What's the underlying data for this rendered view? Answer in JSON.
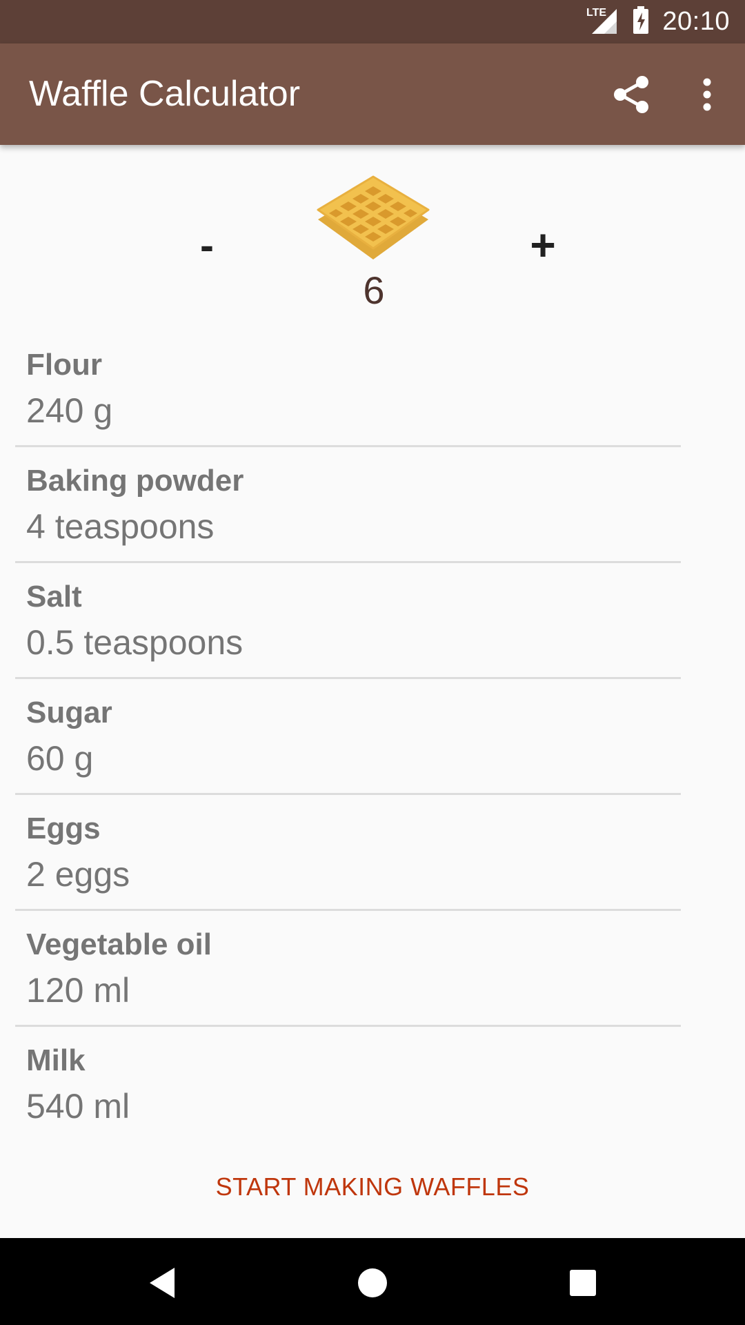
{
  "status_bar": {
    "network": "LTE",
    "time": "20:10",
    "icons": [
      "lte-signal-icon",
      "battery-charging-icon"
    ]
  },
  "app_bar": {
    "title": "Waffle Calculator",
    "actions": [
      "share-icon",
      "more-vert-icon"
    ]
  },
  "counter": {
    "minus_label": "-",
    "plus_label": "+",
    "count": "6",
    "icon": "waffle-icon"
  },
  "ingredients": [
    {
      "name": "Flour",
      "amount": "240 g"
    },
    {
      "name": "Baking powder",
      "amount": "4 teaspoons"
    },
    {
      "name": "Salt",
      "amount": "0.5 teaspoons"
    },
    {
      "name": "Sugar",
      "amount": "60 g"
    },
    {
      "name": "Eggs",
      "amount": "2 eggs"
    },
    {
      "name": "Vegetable oil",
      "amount": "120 ml"
    },
    {
      "name": "Milk",
      "amount": "540 ml"
    }
  ],
  "actions": {
    "start_label": "START MAKING WAFFLES"
  },
  "nav_bar": {
    "buttons": [
      "back-icon",
      "home-icon",
      "recents-icon"
    ]
  },
  "colors": {
    "status_bar": "#5d4037",
    "app_bar": "#795548",
    "accent": "#bf360c",
    "count_text": "#4e342e",
    "waffle": "#f2c14e"
  }
}
